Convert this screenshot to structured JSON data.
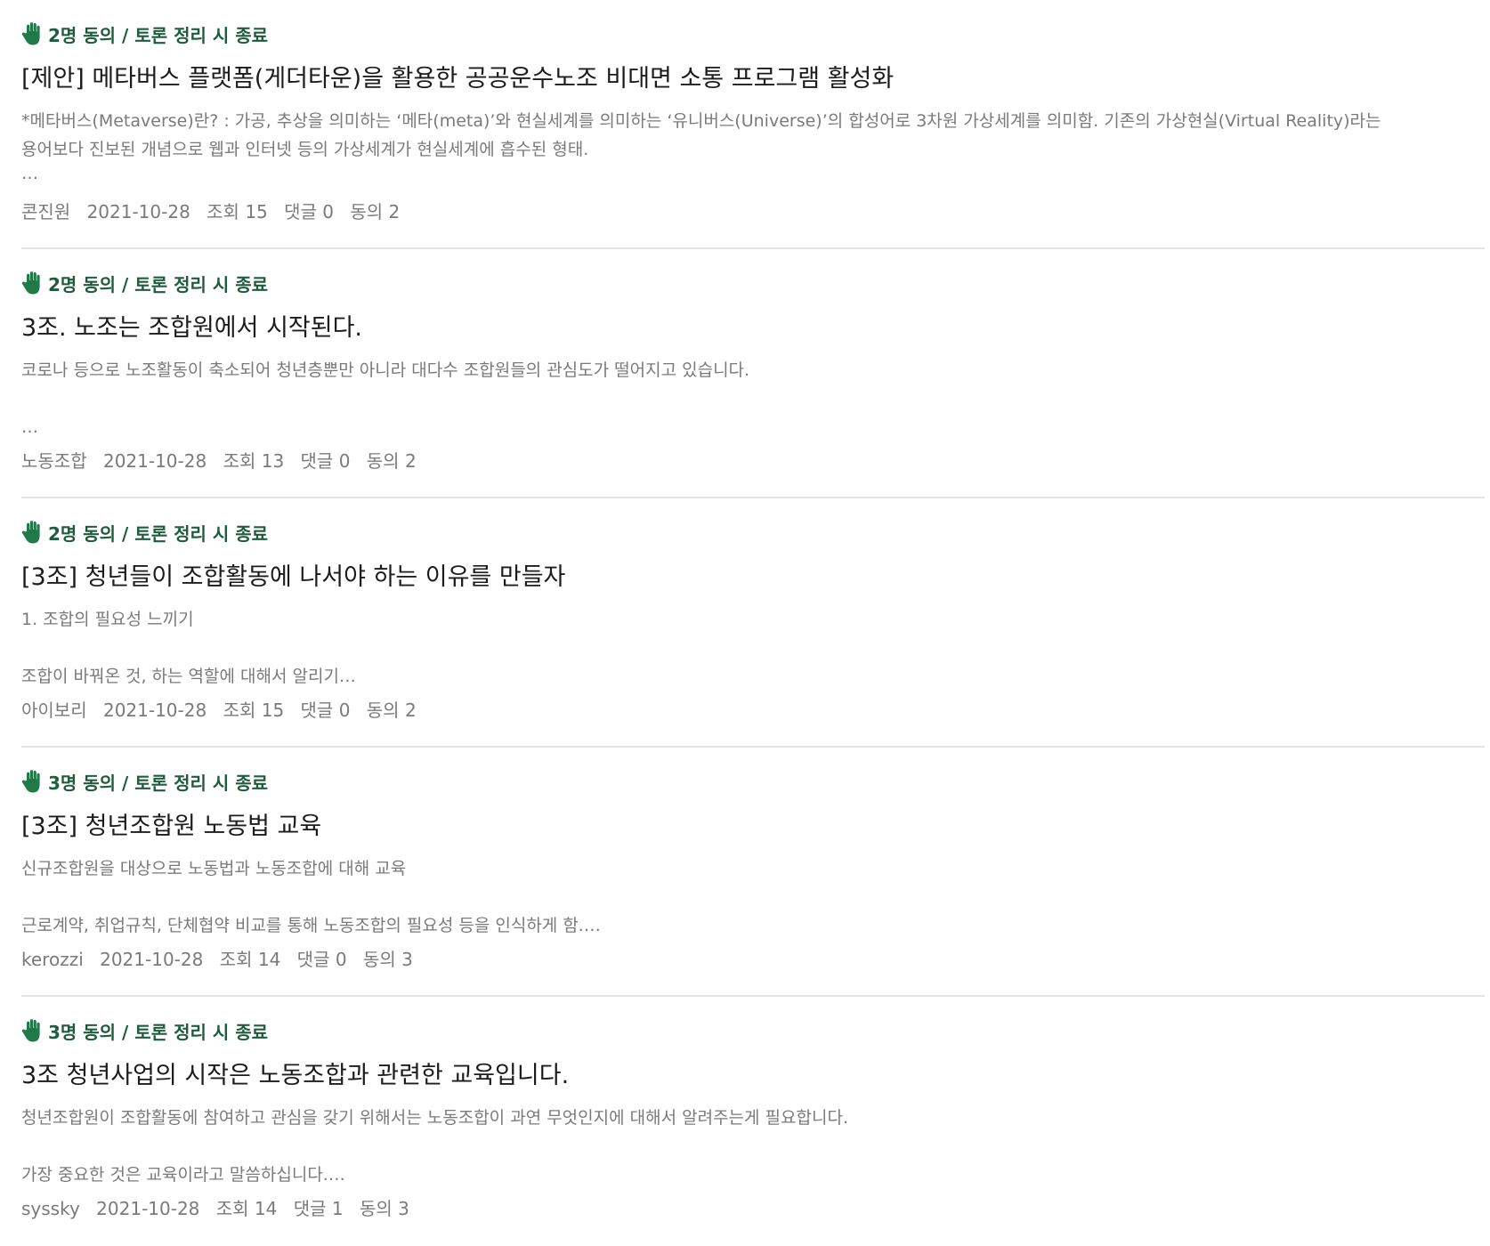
{
  "posts": [
    {
      "status": "2명 동의 / 토론 정리 시 종료",
      "title": "[제안] 메타버스 플랫폼(게더타운)을 활용한 공공운수노조 비대면 소통 프로그램 활성화",
      "excerpt": [
        "*메타버스(Metaverse)란? : 가공, 추상을 의미하는 ‘메타(meta)’와 현실세계를 의미하는 ‘유니버스(Universe)’의 합성어로 3차원 가상세계를 의미함. 기존의 가상현실(Virtual Reality)라는",
        "용어보다 진보된 개념으로 웹과 인터넷 등의 가상세계가 현실세계에 흡수된 형태.",
        "…"
      ],
      "author": "콘진원",
      "date": "2021-10-28",
      "views": "조회 15",
      "comments": "댓글 0",
      "agrees": "동의 2"
    },
    {
      "status": "2명 동의 / 토론 정리 시 종료",
      "title": "3조. 노조는 조합원에서 시작된다.",
      "excerpt": [
        "코로나 등으로 노조활동이 축소되어 청년층뿐만 아니라 대다수 조합원들의 관심도가 떨어지고 있습니다.",
        "",
        "…"
      ],
      "author": "노동조합",
      "date": "2021-10-28",
      "views": "조회 13",
      "comments": "댓글 0",
      "agrees": "동의 2"
    },
    {
      "status": "2명 동의 / 토론 정리 시 종료",
      "title": "[3조] 청년들이 조합활동에 나서야 하는 이유를 만들자",
      "excerpt": [
        "1. 조합의 필요성 느끼기",
        "",
        "조합이 바꿔온 것, 하는 역할에 대해서 알리기…"
      ],
      "author": "아이보리",
      "date": "2021-10-28",
      "views": "조회 15",
      "comments": "댓글 0",
      "agrees": "동의 2"
    },
    {
      "status": "3명 동의 / 토론 정리 시 종료",
      "title": "[3조] 청년조합원 노동법 교육",
      "excerpt": [
        "신규조합원을 대상으로 노동법과 노동조합에 대해 교육",
        "",
        "근로계약, 취업규칙, 단체협약 비교를 통해 노동조합의 필요성 등을 인식하게 함.…"
      ],
      "author": "kerozzi",
      "date": "2021-10-28",
      "views": "조회 14",
      "comments": "댓글 0",
      "agrees": "동의 3"
    },
    {
      "status": "3명 동의 / 토론 정리 시 종료",
      "title": "3조 청년사업의 시작은 노동조합과 관련한 교육입니다.",
      "excerpt": [
        "청년조합원이 조합활동에 참여하고 관심을 갖기 위해서는 노동조합이 과연 무엇인지에 대해서 알려주는게 필요합니다.",
        "",
        "가장 중요한 것은 교육이라고 말씀하십니다.…"
      ],
      "author": "syssky",
      "date": "2021-10-28",
      "views": "조회 14",
      "comments": "댓글 1",
      "agrees": "동의 3"
    }
  ],
  "colors": {
    "status": "#1f5c3e",
    "hand_icon": "#1f7a47",
    "title": "#1c1c1c",
    "muted": "#7a7a7a",
    "divider": "#e3e3e3"
  },
  "icons": {
    "status": "raised-hand-icon"
  }
}
